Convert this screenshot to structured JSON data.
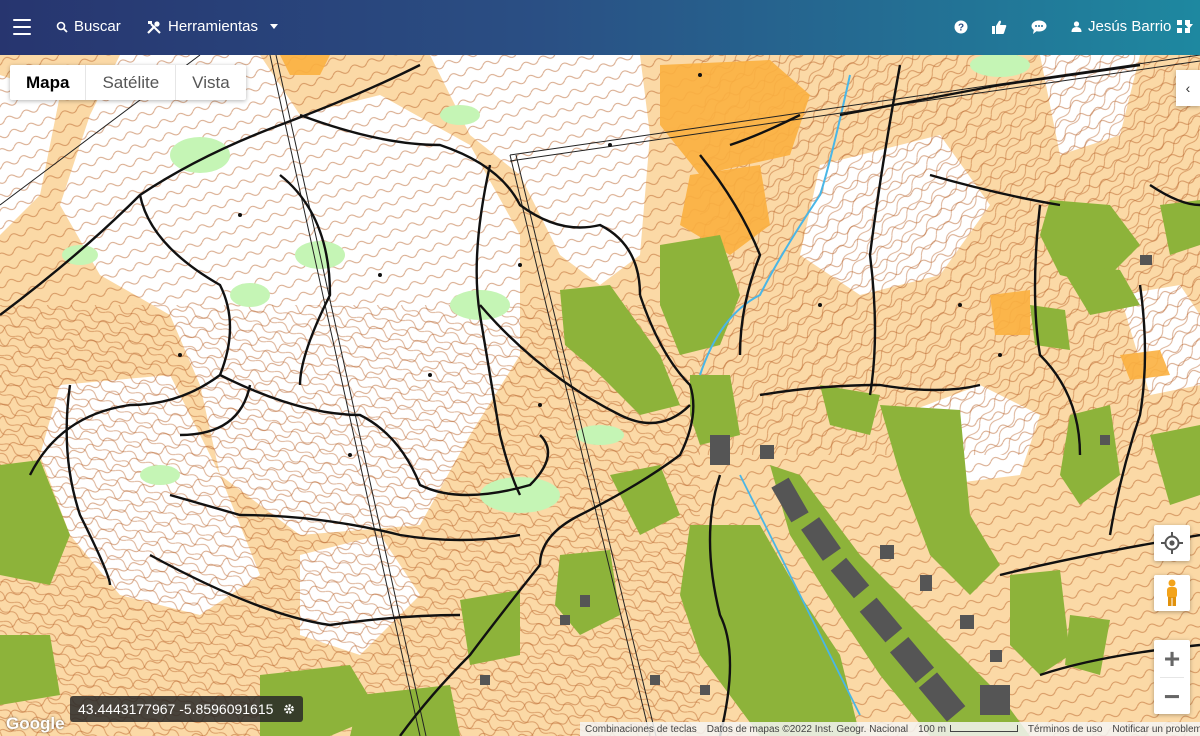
{
  "nav": {
    "search_label": "Buscar",
    "tools_label": "Herramientas",
    "user_name": "Jesús Barrio"
  },
  "map_type": {
    "options": [
      "Mapa",
      "Satélite",
      "Vista"
    ],
    "selected": "Mapa"
  },
  "coordinates": "43.4443177967 -5.8596091615",
  "google_logo": "Google",
  "attribution": {
    "shortcuts": "Combinaciones de teclas",
    "map_data": "Datos de mapas ©2022 Inst. Geogr. Nacional",
    "scale": "100 m",
    "terms": "Términos de uso",
    "report": "Notificar un problema de Maps"
  },
  "controls": {
    "zoom_in": "+",
    "zoom_out": "−",
    "collapse": "‹"
  },
  "colors": {
    "open_land": "#fbd9a6",
    "rough_open": "#fbb040",
    "forest": "#ffffff",
    "green": "#8db33a",
    "light_green": "#c5f5b5",
    "contour": "#b8622a",
    "building": "#555555",
    "path": "#111111"
  }
}
